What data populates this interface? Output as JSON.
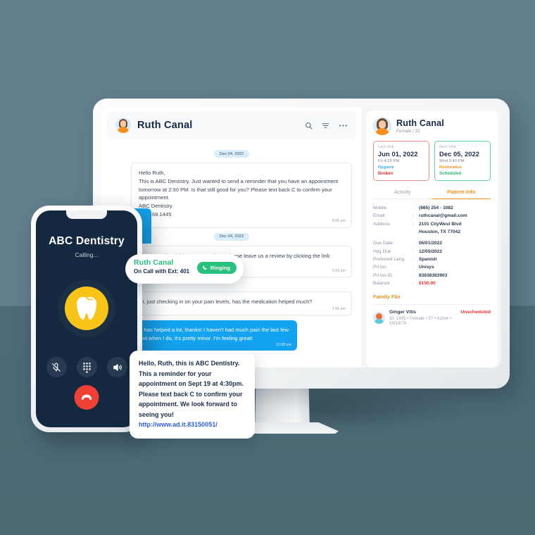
{
  "background": {
    "top_color": "#637f8d",
    "bottom_color": "#4e6b77"
  },
  "chat": {
    "header": {
      "title": "Ruth Canal",
      "avatar_name": "ruth-canal-avatar",
      "icons": [
        "search-icon",
        "filter-icon",
        "more-options-icon"
      ]
    },
    "messages": [
      {
        "date_chip": "Dec 04, 2022",
        "direction": "incoming",
        "text": "Hello Ruth,\nThis is ABC Dentistry. Just wanted to send a reminder that you have an appointment tomorrow at 2:30 PM. Is that still good for you? Please text back C to confirm your appointment.\nABC Dentistry\n281.468.1445",
        "time": "8:00 pm"
      },
      {
        "date_chip": "Dec 04, 2022",
        "direction": "incoming",
        "text": "Thank you for visiting ABC Dentistry, please leave us a review by clicking the link below:",
        "time": "5:00 pm"
      },
      {
        "date_chip": "",
        "direction": "incoming",
        "text": "Hi, just checking in on your pain levels, has the medication helped much?",
        "time": "1:06 pm"
      },
      {
        "date_chip": "",
        "direction": "outgoing",
        "text": "It really has helped a lot, thanks! I haven't had much pain the last few days and when I do, it's pretty minor. I'm feeling great!",
        "time": "10:08 pm"
      }
    ]
  },
  "patient": {
    "name": "Ruth Canal",
    "subtitle": "Female / 32",
    "visits": [
      {
        "label": "Last Visit",
        "date": "Jun 01, 2022",
        "time": "Fri 4:20 PM",
        "type": "Hygiene",
        "type_color": "#37a7e8",
        "status": "Broken",
        "status_color": "#e8312f",
        "border_color": "#f08b8b"
      },
      {
        "label": "Next Visit",
        "date": "Dec 05, 2022",
        "time": "Wed 2:40 PM",
        "type": "Restorative",
        "type_color": "#f7941d",
        "status": "Scheduled",
        "status_color": "#2fb76e",
        "border_color": "#5fd19a"
      }
    ],
    "tabs": [
      {
        "label": "Activity",
        "active": false
      },
      {
        "label": "Patient Info",
        "active": true
      }
    ],
    "tab_active_color": "#f7941d",
    "info": [
      {
        "key": "Mobile",
        "value": "(865) 254 - 1082"
      },
      {
        "key": "Email",
        "value": "ruthcanal@gmail.com"
      },
      {
        "key": "Address",
        "value": "2101 CityWest Blvd"
      },
      {
        "key": "",
        "value": "Houston, TX 77042"
      },
      {
        "key": "Due Date",
        "value": "06/01/2022"
      },
      {
        "key": "Hyg Due",
        "value": "12/05/2022"
      },
      {
        "key": "Preferred Lang.",
        "value": "Spanish"
      },
      {
        "key": "Pri Ins",
        "value": "Unisys"
      },
      {
        "key": "Pri Ins ID",
        "value": "83838383903"
      },
      {
        "key": "Balance",
        "value": "$150.00",
        "money": true
      }
    ],
    "family": {
      "title": "Family File",
      "member_name": "Ginger Vitis",
      "member_meta": "ID: 1485 • Female • 27 • Active • 03/14/78",
      "member_status": "Unscheduled",
      "status_color": "#e8312f"
    }
  },
  "phone": {
    "caller": "ABC Dentistry",
    "status": "Calling...",
    "logo_name": "tooth-logo",
    "logo_color": "#f9c418",
    "controls": [
      "mute-icon",
      "keypad-icon",
      "speaker-icon"
    ],
    "end_call": "end-call-icon",
    "end_call_color": "#ef4136"
  },
  "call_popup": {
    "name": "Ruth Canal",
    "subtitle": "On Call with Ext: 401",
    "badge_label": "Ringing",
    "badge_color": "#27c07d"
  },
  "sms_bubble": {
    "text": "Hello, Ruth, this is ABC Dentistry. This a reminder for your appointment on Sept 19 at 4:30pm. Please text back C to confirm your appointment. We look forward to seeing you! ",
    "link": "http://www.ad.it.83150051/"
  }
}
